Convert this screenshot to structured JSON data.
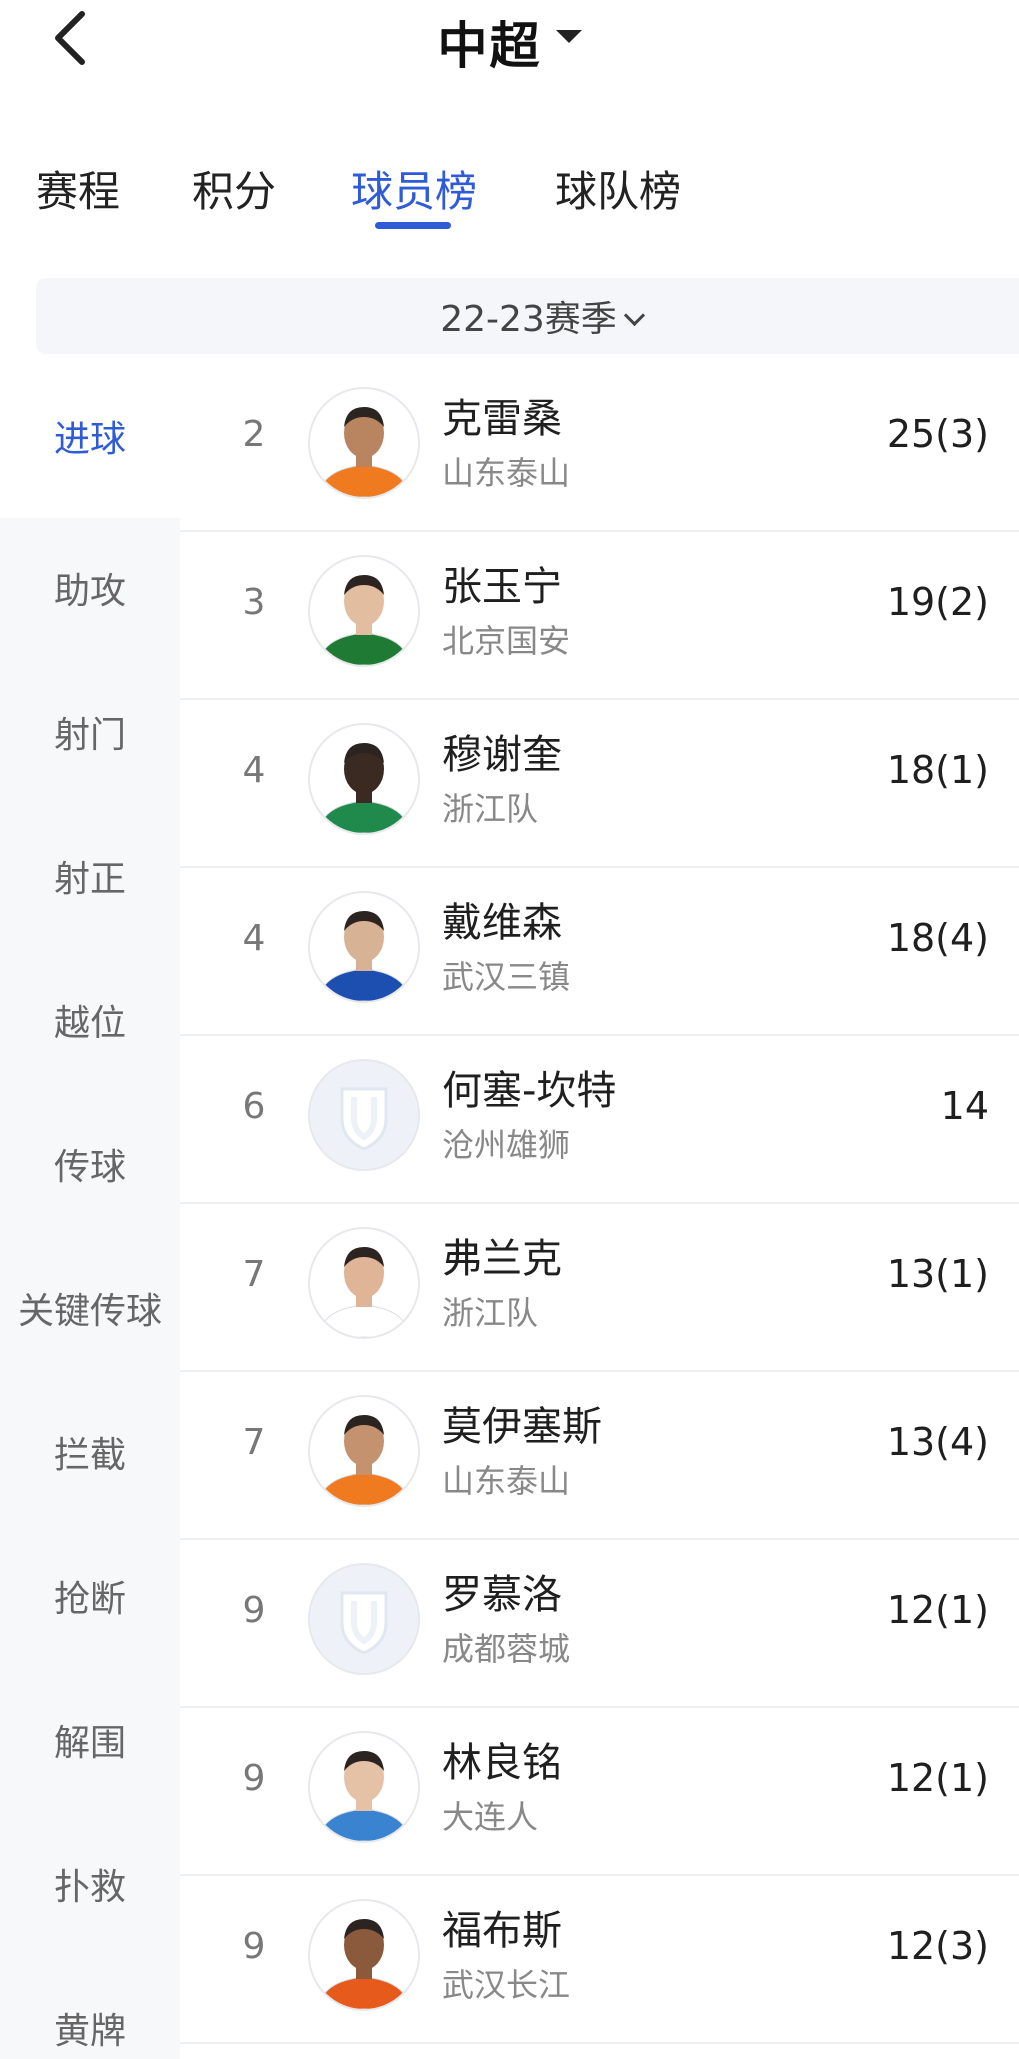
{
  "header": {
    "title": "中超"
  },
  "tabs": [
    {
      "label": "赛程"
    },
    {
      "label": "积分"
    },
    {
      "label": "球员榜"
    },
    {
      "label": "球队榜"
    }
  ],
  "season": {
    "label": "22-23赛季"
  },
  "sidebar": {
    "items": [
      {
        "label": "进球"
      },
      {
        "label": "助攻"
      },
      {
        "label": "射门"
      },
      {
        "label": "射正"
      },
      {
        "label": "越位"
      },
      {
        "label": "传球"
      },
      {
        "label": "关键传球"
      },
      {
        "label": "拦截"
      },
      {
        "label": "抢断"
      },
      {
        "label": "解围"
      },
      {
        "label": "扑救"
      },
      {
        "label": "黄牌"
      }
    ]
  },
  "players": [
    {
      "rank": "2",
      "name": "克雷桑",
      "team": "山东泰山",
      "stat": "25(3)",
      "skin": "#b98560",
      "shirt": "#f07a1f"
    },
    {
      "rank": "3",
      "name": "张玉宁",
      "team": "北京国安",
      "stat": "19(2)",
      "skin": "#e2bda0",
      "shirt": "#1f7a34"
    },
    {
      "rank": "4",
      "name": "穆谢奎",
      "team": "浙江队",
      "stat": "18(1)",
      "skin": "#3a2a22",
      "shirt": "#1f8a4c"
    },
    {
      "rank": "4",
      "name": "戴维森",
      "team": "武汉三镇",
      "stat": "18(4)",
      "skin": "#d8b294",
      "shirt": "#1d4fb0"
    },
    {
      "rank": "6",
      "name": "何塞-坎特",
      "team": "沧州雄狮",
      "stat": "14",
      "skin": "",
      "shirt": ""
    },
    {
      "rank": "7",
      "name": "弗兰克",
      "team": "浙江队",
      "stat": "13(1)",
      "skin": "#e0b496",
      "shirt": "#ffffff"
    },
    {
      "rank": "7",
      "name": "莫伊塞斯",
      "team": "山东泰山",
      "stat": "13(4)",
      "skin": "#c4926e",
      "shirt": "#f07a1f"
    },
    {
      "rank": "9",
      "name": "罗慕洛",
      "team": "成都蓉城",
      "stat": "12(1)",
      "skin": "",
      "shirt": ""
    },
    {
      "rank": "9",
      "name": "林良铭",
      "team": "大连人",
      "stat": "12(1)",
      "skin": "#e5c2a6",
      "shirt": "#3a83d0"
    },
    {
      "rank": "9",
      "name": "福布斯",
      "team": "武汉长江",
      "stat": "12(3)",
      "skin": "#8b5a3c",
      "shirt": "#e65a1c"
    }
  ]
}
